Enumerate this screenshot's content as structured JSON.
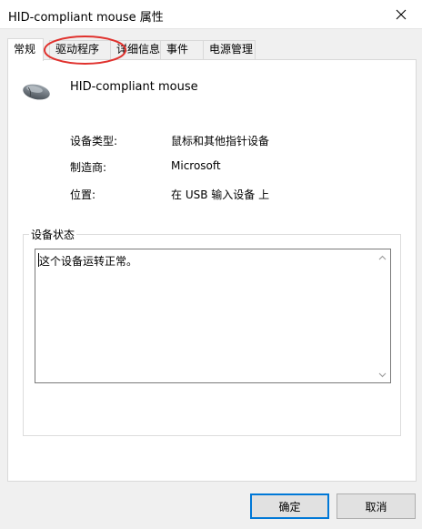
{
  "window": {
    "title": "HID-compliant mouse 属性",
    "close_glyph": "✕"
  },
  "tabs": [
    {
      "label": "常规",
      "active": true
    },
    {
      "label": "驱动程序",
      "active": false
    },
    {
      "label": "详细信息",
      "active": false
    },
    {
      "label": "事件",
      "active": false
    },
    {
      "label": "电源管理",
      "active": false
    }
  ],
  "device": {
    "name": "HID-compliant mouse",
    "icon": "mouse-icon"
  },
  "properties": [
    {
      "label": "设备类型:",
      "value": "鼠标和其他指针设备"
    },
    {
      "label": "制造商:",
      "value": "Microsoft"
    },
    {
      "label": "位置:",
      "value": "在 USB 输入设备 上"
    }
  ],
  "status": {
    "group_label": "设备状态",
    "text": "这个设备运转正常。"
  },
  "buttons": {
    "ok": "确定",
    "cancel": "取消"
  },
  "colors": {
    "annotation": "#e0312d",
    "accent": "#0078d7"
  }
}
